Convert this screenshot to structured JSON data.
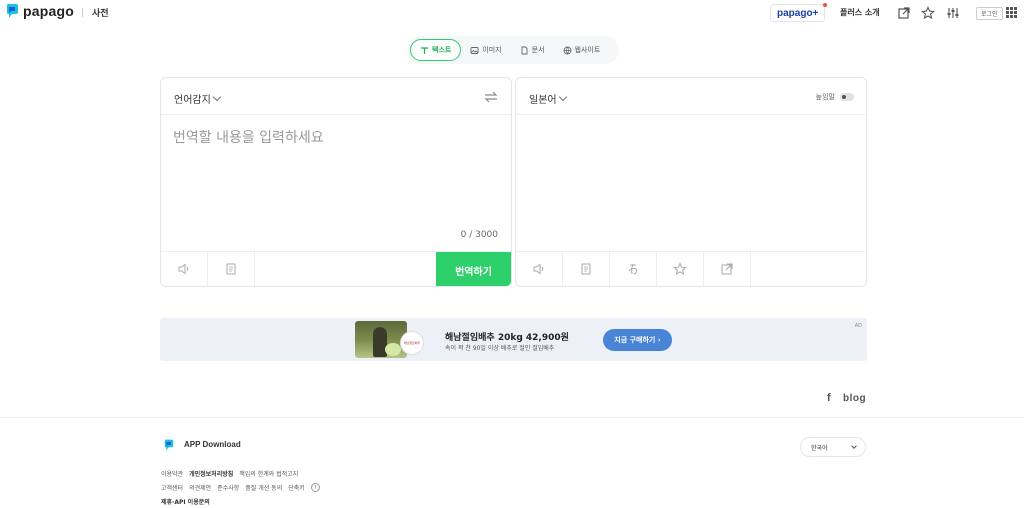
{
  "header": {
    "logo_text": "papago",
    "nav_dictionary": "사전",
    "papago_plus_label": "papago+",
    "plus_intro_label": "플러스 소개",
    "login_label": "로그인",
    "icons": [
      "share-window-icon",
      "star-icon",
      "settings-sliders-icon",
      "apps-grid-icon"
    ]
  },
  "tabs": [
    {
      "label": "텍스트",
      "icon": "text-icon",
      "active": true
    },
    {
      "label": "이미지",
      "icon": "image-icon",
      "active": false
    },
    {
      "label": "문서",
      "icon": "document-icon",
      "active": false
    },
    {
      "label": "웹사이트",
      "icon": "globe-icon",
      "active": false
    }
  ],
  "source_panel": {
    "language": "언어감지",
    "placeholder": "번역할 내용을 입력하세요",
    "value": "",
    "char_count": "0 / 3000",
    "translate_button": "번역하기"
  },
  "target_panel": {
    "language": "일본어",
    "honorific_label": "높임말",
    "honorific_on": false
  },
  "ad": {
    "title": "해남절임배추 20kg 42,900원",
    "subtitle": "속이 꽉 찬 90일 이상 배추로 절인 절임배추",
    "cta": "지금 구매하기 ›",
    "badge_text": "해남절임배추",
    "label": "AD"
  },
  "social": {
    "facebook": "f",
    "blog": "blog"
  },
  "footer": {
    "app_download": "APP Download",
    "language_selector": "한국어",
    "links_row1": [
      "이용약관",
      "개인정보처리방침",
      "책임의 한계와 법적고지"
    ],
    "links_row2": [
      "고객센터",
      "의견제안",
      "준수사항",
      "품질 개선 동의",
      "단축키"
    ],
    "links_row3": [
      "제휴·API 이용문의"
    ],
    "help_glyph": "?"
  },
  "colors": {
    "accent_green": "#2ed06b",
    "ad_background": "#edf1f7",
    "ad_cta": "#4a84d6",
    "brand_blue": "#1a3ea5"
  }
}
